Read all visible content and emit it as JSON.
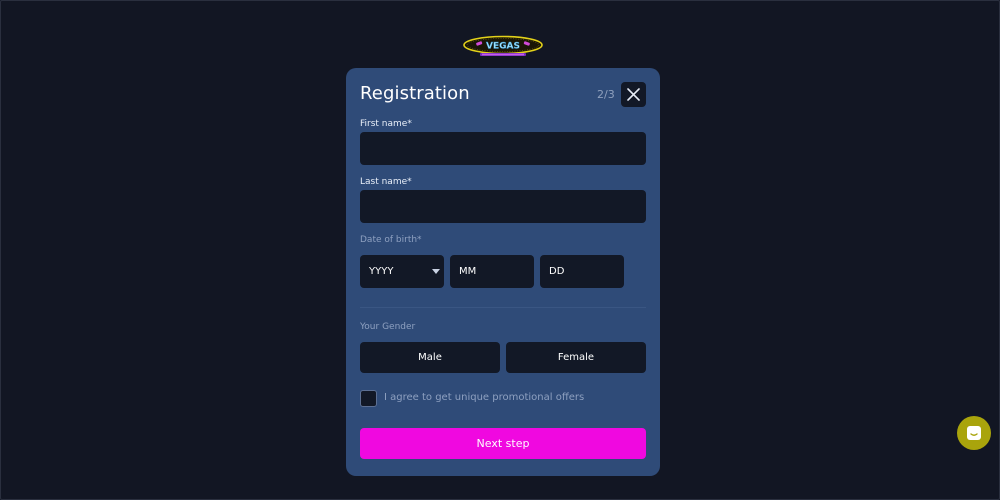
{
  "logo": {
    "text": "VEGAS",
    "icon": "casino-logo-icon"
  },
  "modal": {
    "title": "Registration",
    "step": "2/3",
    "close_icon": "close-icon",
    "first_name": {
      "label": "First name*",
      "value": "",
      "placeholder": ""
    },
    "last_name": {
      "label": "Last name*",
      "value": "",
      "placeholder": ""
    },
    "dob": {
      "label": "Date of birth*",
      "year": "YYYY",
      "month": "MM",
      "day": "DD"
    },
    "gender": {
      "label": "Your Gender",
      "options": [
        "Male",
        "Female"
      ]
    },
    "promo": {
      "label": "I agree to get unique promotional offers",
      "checked": false
    },
    "next_label": "Next step"
  },
  "chat": {
    "icon": "chat-icon"
  },
  "colors": {
    "background": "#121623",
    "modal": "#2f4b78",
    "field": "#121826",
    "accent": "#f008e0",
    "chat": "#a9a40c"
  }
}
